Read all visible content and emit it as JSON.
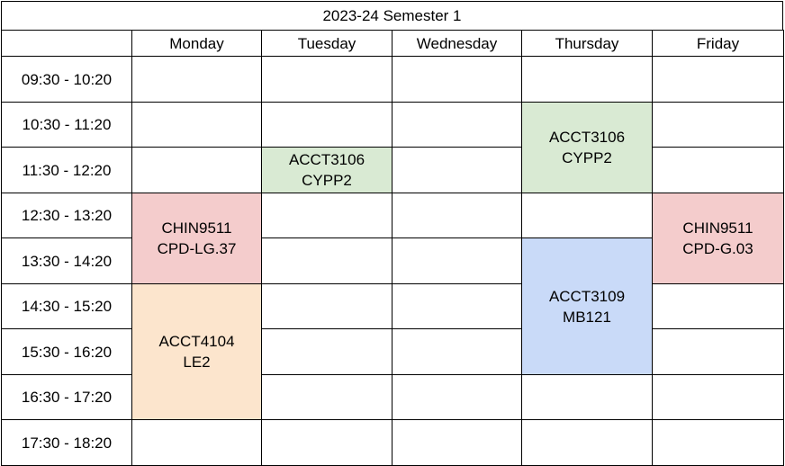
{
  "timetable": {
    "title": "2023-24 Semester 1",
    "days": [
      "Monday",
      "Tuesday",
      "Wednesday",
      "Thursday",
      "Friday"
    ],
    "times": [
      "09:30 - 10:20",
      "10:30 - 11:20",
      "11:30 - 12:20",
      "12:30 - 13:20",
      "13:30 - 14:20",
      "14:30 - 15:20",
      "15:30 - 16:20",
      "16:30 - 17:20",
      "17:30 - 18:20"
    ],
    "events": [
      {
        "day": 1,
        "start": 2,
        "span": 1,
        "code": "ACCT3106",
        "room": "CYPP2",
        "color": "#d9ead3"
      },
      {
        "day": 3,
        "start": 1,
        "span": 2,
        "code": "ACCT3106",
        "room": "CYPP2",
        "color": "#d9ead3"
      },
      {
        "day": 0,
        "start": 3,
        "span": 2,
        "code": "CHIN9511",
        "room": "CPD-LG.37",
        "color": "#f4cccc"
      },
      {
        "day": 4,
        "start": 3,
        "span": 2,
        "code": "CHIN9511",
        "room": "CPD-G.03",
        "color": "#f4cccc"
      },
      {
        "day": 0,
        "start": 5,
        "span": 3,
        "code": "ACCT4104",
        "room": "LE2",
        "color": "#fce5cd"
      },
      {
        "day": 3,
        "start": 4,
        "span": 3,
        "code": "ACCT3109",
        "room": "MB121",
        "color": "#c9daf8"
      }
    ]
  }
}
